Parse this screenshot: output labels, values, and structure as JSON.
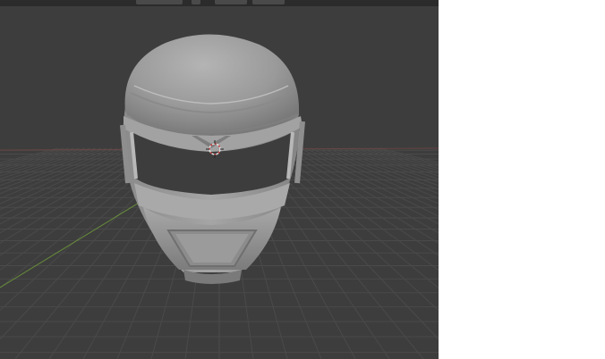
{
  "app": {
    "name": ""
  },
  "viewport": {
    "background_color": "#3d3d3d",
    "grid_color": "#4a4a4a",
    "axis_x_color": "#8a4a4a",
    "axis_y_color": "#6f9a3a",
    "model_color": "#9d9d9d",
    "object": "helmet-mesh"
  },
  "header": {
    "buttons": [
      {
        "icon": "view-dropdown-icon",
        "label": ""
      },
      {
        "icon": "gizmo-icon",
        "label": ""
      },
      {
        "icon": "shading-icon",
        "label": ""
      },
      {
        "icon": "overlay-icon",
        "label": ""
      }
    ]
  },
  "panel": {
    "background_color": "#ffffff"
  }
}
